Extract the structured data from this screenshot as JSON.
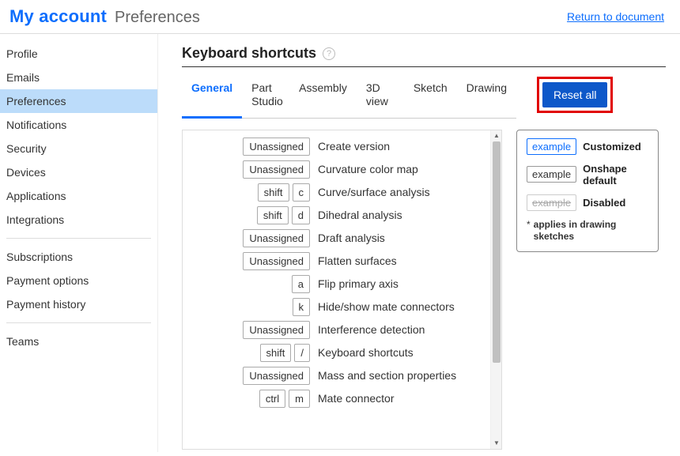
{
  "header": {
    "account_label": "My account",
    "prefs_label": "Preferences",
    "return_link": "Return to document"
  },
  "sidebar": {
    "items": [
      {
        "label": "Profile"
      },
      {
        "label": "Emails"
      },
      {
        "label": "Preferences"
      },
      {
        "label": "Notifications"
      },
      {
        "label": "Security"
      },
      {
        "label": "Devices"
      },
      {
        "label": "Applications"
      },
      {
        "label": "Integrations"
      }
    ],
    "billing": [
      {
        "label": "Subscriptions"
      },
      {
        "label": "Payment options"
      },
      {
        "label": "Payment history"
      }
    ],
    "org": [
      {
        "label": "Teams"
      }
    ]
  },
  "main": {
    "title": "Keyboard shortcuts",
    "tabs": [
      {
        "label": "General"
      },
      {
        "label": "Part Studio"
      },
      {
        "label": "Assembly"
      },
      {
        "label": "3D view"
      },
      {
        "label": "Sketch"
      },
      {
        "label": "Drawing"
      }
    ],
    "reset_label": "Reset all"
  },
  "shortcuts": [
    {
      "keys": [
        "Unassigned"
      ],
      "desc": "Create version"
    },
    {
      "keys": [
        "Unassigned"
      ],
      "desc": "Curvature color map"
    },
    {
      "keys": [
        "shift",
        "c"
      ],
      "desc": "Curve/surface analysis"
    },
    {
      "keys": [
        "shift",
        "d"
      ],
      "desc": "Dihedral analysis"
    },
    {
      "keys": [
        "Unassigned"
      ],
      "desc": "Draft analysis"
    },
    {
      "keys": [
        "Unassigned"
      ],
      "desc": "Flatten surfaces"
    },
    {
      "keys": [
        "a"
      ],
      "desc": "Flip primary axis"
    },
    {
      "keys": [
        "k"
      ],
      "desc": "Hide/show mate connectors"
    },
    {
      "keys": [
        "Unassigned"
      ],
      "desc": "Interference detection"
    },
    {
      "keys": [
        "shift",
        "/"
      ],
      "desc": "Keyboard shortcuts"
    },
    {
      "keys": [
        "Unassigned"
      ],
      "desc": "Mass and section properties"
    },
    {
      "keys": [
        "ctrl",
        "m"
      ],
      "desc": "Mate connector"
    }
  ],
  "legend": {
    "example_chip": "example",
    "customized": "Customized",
    "default": "Onshape default",
    "disabled": "Disabled",
    "note_ast": "*",
    "note": "applies in drawing sketches"
  }
}
